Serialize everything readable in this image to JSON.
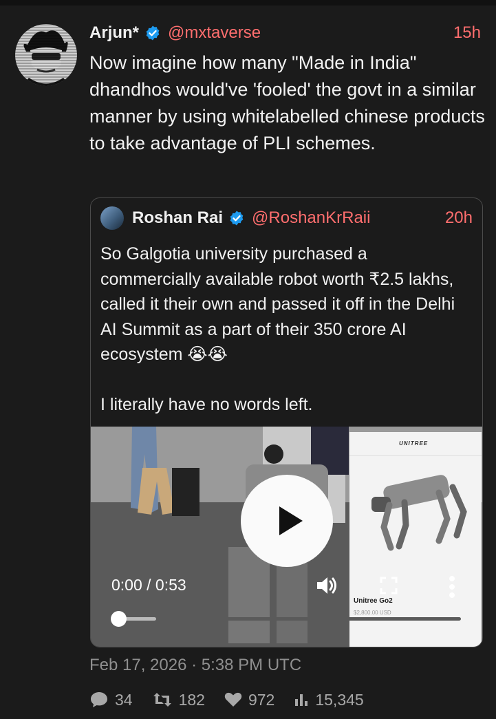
{
  "tweet": {
    "author_name": "Arjun*",
    "handle": "@mxtaverse",
    "time": "15h",
    "text": "Now imagine how many \"Made in India\" dhandhos would've 'fooled' the govt in a similar manner by using whitelabelled chinese products to take advantage of PLI schemes."
  },
  "quote": {
    "author_name": "Roshan Rai",
    "handle": "@RoshanKrRaii",
    "time": "20h",
    "text": "So Galgotia university purchased a commercially available robot worth ₹2.5 lakhs, called it their own and passed it off in the Delhi AI Summit as a part of their 350 crore AI ecosystem 😭😭\n\nI literally have no words left."
  },
  "video": {
    "time_display": "0:00 / 0:53",
    "progress": 0.0,
    "buffered": 0.11,
    "embedded_site": {
      "brand": "UNITREE",
      "product_name": "Unitree Go2",
      "price": "$2,800.00 USD"
    }
  },
  "meta": {
    "date": "Feb 17, 2026 · 5:38 PM UTC"
  },
  "stats": {
    "replies": "34",
    "retweets": "182",
    "likes": "972",
    "views": "15,345"
  },
  "colors": {
    "background": "#1b1b1b",
    "accent": "#ff6e6e",
    "verified": "#1d9bf0",
    "muted": "#8f8f8f"
  }
}
